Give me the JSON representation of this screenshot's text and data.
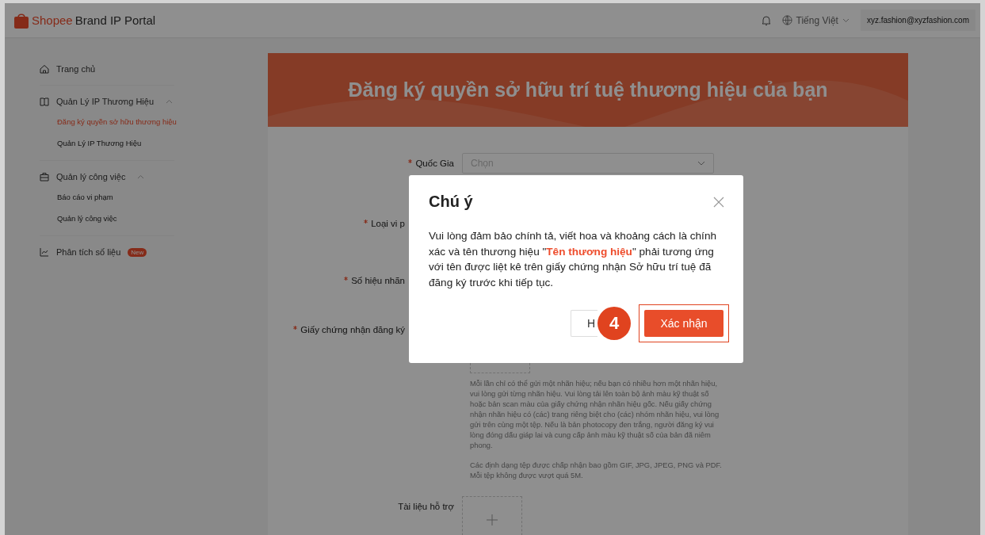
{
  "header": {
    "logo_brand": "Shopee",
    "logo_product": "Brand IP Portal",
    "language": "Tiếng Việt",
    "account": "xyz.fashion@xyzfashion.com"
  },
  "sidebar": {
    "items": [
      {
        "kind": "link",
        "label": "Trang chủ"
      },
      {
        "kind": "group",
        "label": "Quản Lý IP Thương Hiệu",
        "expanded": true,
        "children": [
          {
            "label": "Đăng ký quyền sở hữu thương hiệu",
            "selected": true
          },
          {
            "label": "Quản Lý IP Thương Hiệu",
            "selected": false
          }
        ]
      },
      {
        "kind": "group",
        "label": "Quản lý công việc",
        "expanded": true,
        "children": [
          {
            "label": "Báo cáo vi phạm",
            "selected": false
          },
          {
            "label": "Quản lý công việc",
            "selected": false
          }
        ]
      },
      {
        "kind": "link",
        "label": "Phân tích số liệu",
        "badge": "New"
      }
    ]
  },
  "banner": {
    "title": "Đăng ký quyền sở hữu trí tuệ thương hiệu của bạn"
  },
  "form": {
    "fields": [
      {
        "kind": "select",
        "label": "Quốc Gia",
        "required": true,
        "placeholder": "Chọn"
      },
      {
        "kind": "covered",
        "label": "Loại vi p",
        "required": true
      },
      {
        "kind": "covered",
        "label": "Số hiệu nhãn",
        "required": true
      },
      {
        "kind": "upload",
        "label": "Giấy chứng nhận đăng ký",
        "required": true,
        "help": [
          "Mỗi lần chỉ có thể gửi một nhãn hiệu; nếu bạn có nhiều hơn một nhãn hiệu, vui lòng gửi từng nhãn hiệu. Vui lòng tải lên toàn bộ ảnh màu kỹ thuật số hoặc bản scan màu của giấy chứng nhận nhãn hiệu gốc. Nếu giấy chứng nhận nhãn hiệu có (các) trang riêng biệt cho (các) nhóm nhãn hiệu, vui lòng gửi trên cùng một tệp. Nếu là bản photocopy đen trắng, người đăng ký vui lòng đóng dấu giáp lai và cung cấp ảnh màu kỹ thuật số của bản đã niêm phong.",
          "Các định dạng tệp được chấp nhận bao gồm GIF, JPG, JPEG, PNG và PDF. Mỗi tệp không được vượt quá 5M."
        ]
      },
      {
        "kind": "upload",
        "label": "Tài liệu hỗ trợ",
        "required": false
      }
    ]
  },
  "modal": {
    "title": "Chú ý",
    "message": "Vui lòng đảm bảo chính tả, viết hoa và khoảng cách là chính xác và tên thương hiệu \"**Tên thương hiệu**\" phải tương ứng với tên được liệt kê trên giấy chứng nhận Sở hữu trí tuệ đã đăng ký trước khi tiếp tục.",
    "cancel_label": "H",
    "confirm_label": "Xác nhận",
    "step": "4"
  }
}
